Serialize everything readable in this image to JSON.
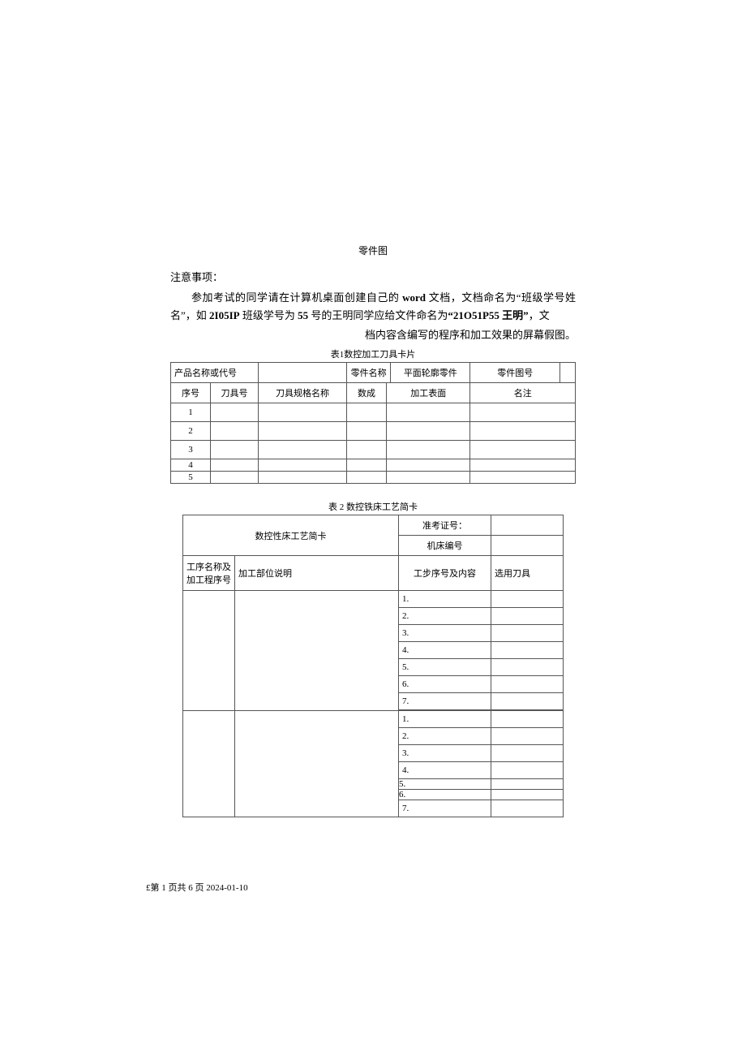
{
  "figure_caption": "零件图",
  "notes": {
    "heading": "注意事项：",
    "line1_a": "参加考试的同学请在计算机桌面创建自己的 ",
    "line1_b": "word",
    "line1_c": " 文档，文档命名为“班级学号姓名”，如 ",
    "line1_d": "2I05IP",
    "line1_e": " 班级学号为 ",
    "line1_f": "55",
    "line1_g": " 号的王明同学应给文件命名为",
    "line1_h": "“21O51P55 王明”",
    "line1_i": "，文",
    "line2": "档内容含编写的程序和加工效果的屏幕假图。"
  },
  "table1": {
    "caption": "表1数控加工刀具卡片",
    "h_product": "产品名称或代号",
    "h_partname": "零件名称",
    "v_partname": "平面轮廓零件",
    "h_partno": "零件图号",
    "c_seq": "序号",
    "c_toolno": "刀具号",
    "c_toolspec": "刀具规格名称",
    "c_qty": "数成",
    "c_surface": "加工表面",
    "c_note": "名注",
    "rows": [
      "1",
      "2",
      "3",
      "4",
      "5"
    ]
  },
  "table2": {
    "caption": "表 2 数控铁床工艺简卡",
    "title": "数控性床工艺简卡",
    "exam_no": "准考证号：",
    "machine_no": "机床编号",
    "col_proc": "工序名称及加工程序号",
    "col_desc": "加工部位说明",
    "col_step": "工步序号及内容",
    "col_tool": "选用刀具",
    "steps_a": [
      "1.",
      "2.",
      "3.",
      "4.",
      "5.",
      "6.",
      "7."
    ],
    "steps_b": [
      "1.",
      "2.",
      "3.",
      "4.",
      "5.",
      "6.",
      "7."
    ]
  },
  "footer": "£第 1 页共 6 页 2024-01-10"
}
